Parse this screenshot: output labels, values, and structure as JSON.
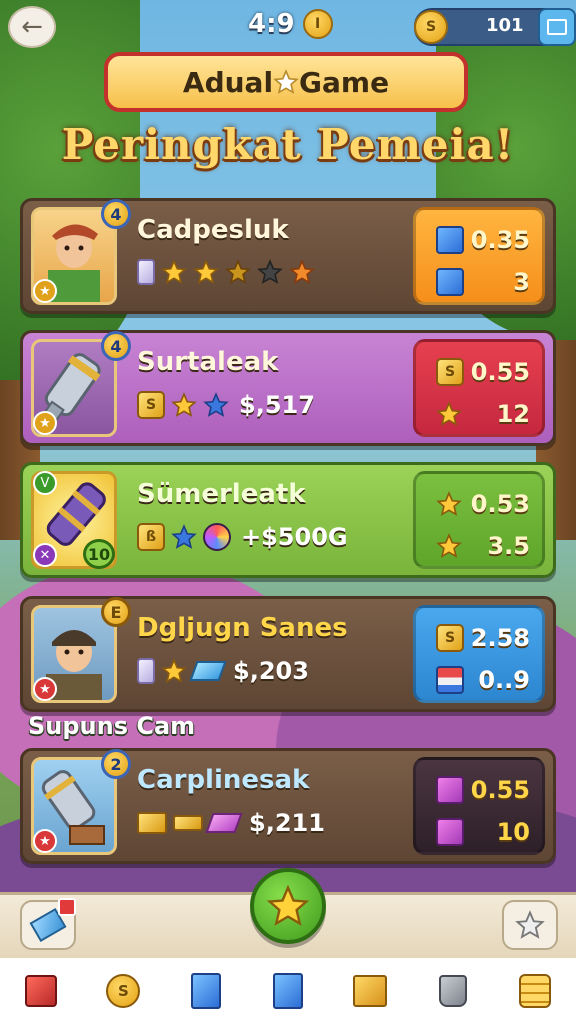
{
  "topbar": {
    "back_icon": "back-arrow-icon",
    "timer": "4:9",
    "timer_coin_glyph": "I",
    "currency_value": "101",
    "currency_coin_glyph": "S"
  },
  "title": {
    "plate_left": "Adual",
    "plate_right": "Game",
    "headline": "Peringkat Pemeia!"
  },
  "rows": [
    {
      "name": "Cadpesluk",
      "rank": "4",
      "meta_value": "",
      "score_top": "0.35",
      "score_bottom": "3",
      "panel_color": "#f7a126",
      "row_color": "#6b5240"
    },
    {
      "name": "Surtaleak",
      "rank": "4",
      "meta_value": "$,517",
      "box_glyph": "S",
      "score_top": "0.55",
      "score_bottom": "12",
      "panel_color": "#d9344a",
      "row_color": "#bb73c6"
    },
    {
      "name": "Sümerleatk",
      "rank": "10",
      "top_badge": "V",
      "box_glyph": "ß",
      "meta_value": "+$500G",
      "score_top": "0.53",
      "score_bottom": "3.5",
      "panel_color": "#74b63a",
      "row_color": "#8cc24a"
    },
    {
      "name": "Dgljugn Sanes",
      "rank": "E",
      "meta_value": "$,203",
      "score_top": "2.58",
      "score_bottom": "0..9",
      "box_glyph": "S",
      "panel_color": "#3f9ce0",
      "row_color": "#6b5240"
    },
    {
      "name": "Carplinesak",
      "rank": "2",
      "meta_value": "$,211",
      "score_top": "0.55",
      "score_bottom": "10",
      "panel_color": "#3a2a30",
      "row_color": "#6b5240"
    }
  ],
  "section_label": "Supuns Cam",
  "bottom_nav": [
    "red-box-icon",
    "coin-icon",
    "blue-cube-icon",
    "blue-cube-icon",
    "gold-bars-icon",
    "bag-icon",
    "coin-stack-icon"
  ],
  "nav_coin_glyph": "S",
  "colors": {
    "accent_gold": "#ffd76a",
    "title_border": "#c2312b",
    "center_button": "#4caa22"
  }
}
